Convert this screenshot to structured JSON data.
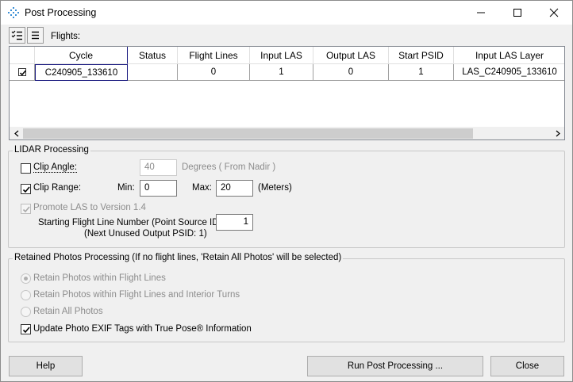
{
  "window": {
    "title": "Post Processing",
    "icon": "app-diamond-icon"
  },
  "toolbar": {
    "flights_label": "Flights:",
    "buttons": [
      "check-list-icon",
      "list-icon"
    ]
  },
  "grid": {
    "columns": [
      "Cycle",
      "Status",
      "Flight Lines",
      "Input LAS",
      "Output LAS",
      "Start PSID",
      "Input LAS Layer"
    ],
    "rows": [
      {
        "checked": true,
        "cycle": "C240905_133610",
        "status": "",
        "flight_lines": "0",
        "input_las": "1",
        "output_las": "0",
        "start_psid": "1",
        "input_las_layer": "LAS_C240905_133610"
      }
    ]
  },
  "lidar": {
    "group_title": "LIDAR Processing",
    "clip_angle": {
      "label": "Clip Angle:",
      "checked": false,
      "value": "40",
      "unit": "Degrees ( From Nadir )"
    },
    "clip_range": {
      "label": "Clip Range:",
      "checked": true,
      "min_label": "Min:",
      "min_value": "0",
      "max_label": "Max:",
      "max_value": "20",
      "unit": "(Meters)"
    },
    "promote": {
      "label": "Promote LAS to Version 1.4",
      "checked": true,
      "disabled": true
    },
    "start_line": {
      "label": "Starting Flight Line Number (Point Source ID):",
      "value": "1",
      "note": "(Next Unused Output PSID: 1)"
    }
  },
  "photos": {
    "group_title": "Retained Photos Processing  (If no flight lines, 'Retain All Photos' will be selected)",
    "options": [
      {
        "label": "Retain Photos within Flight Lines",
        "selected": true
      },
      {
        "label": "Retain Photos within Flight Lines and Interior Turns",
        "selected": false
      },
      {
        "label": "Retain All Photos",
        "selected": false
      }
    ],
    "update_exif": {
      "label": "Update Photo EXIF Tags with True Pose® Information",
      "checked": true
    }
  },
  "buttons": {
    "help": "Help",
    "run": "Run Post Processing ...",
    "close": "Close"
  }
}
